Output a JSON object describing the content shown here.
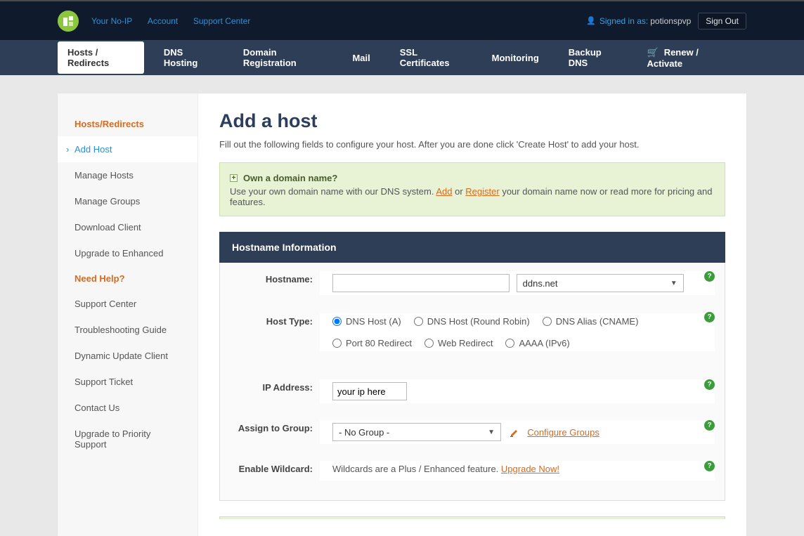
{
  "top": {
    "links": {
      "yourNoIp": "Your No-IP",
      "account": "Account",
      "support": "Support Center"
    },
    "signedInAs": "Signed in as:",
    "username": "potionspvp",
    "signOut": "Sign Out"
  },
  "nav": {
    "hostsRedirects": "Hosts / Redirects",
    "dnsHosting": "DNS Hosting",
    "domainRegistration": "Domain Registration",
    "mail": "Mail",
    "ssl": "SSL Certificates",
    "monitoring": "Monitoring",
    "backupDns": "Backup DNS",
    "renew": "Renew / Activate"
  },
  "sidebar": {
    "heading1": "Hosts/Redirects",
    "addHost": "Add Host",
    "manageHosts": "Manage Hosts",
    "manageGroups": "Manage Groups",
    "downloadClient": "Download Client",
    "upgradeEnhanced": "Upgrade to Enhanced",
    "heading2": "Need Help?",
    "supportCenter": "Support Center",
    "troubleshooting": "Troubleshooting Guide",
    "duc": "Dynamic Update Client",
    "ticket": "Support Ticket",
    "contact": "Contact Us",
    "priority": "Upgrade to Priority Support"
  },
  "page": {
    "title": "Add a host",
    "subtitle": "Fill out the following fields to configure your host. After you are done click 'Create Host' to add your host."
  },
  "infobox": {
    "question": "Own a domain name?",
    "line2a": "Use your own domain name with our DNS system. ",
    "add": "Add",
    "or": " or ",
    "register": "Register",
    "line2b": " your domain name now or read more for pricing and features."
  },
  "panel": {
    "heading": "Hostname Information",
    "labels": {
      "hostname": "Hostname:",
      "hostType": "Host Type:",
      "ip": "IP Address:",
      "group": "Assign to Group:",
      "wildcard": "Enable Wildcard:"
    },
    "hostnameValue": "",
    "domainSelected": "ddns.net",
    "hostTypes": {
      "a": "DNS Host (A)",
      "rr": "DNS Host (Round Robin)",
      "cname": "DNS Alias (CNAME)",
      "port80": "Port 80 Redirect",
      "web": "Web Redirect",
      "aaaa": "AAAA (IPv6)"
    },
    "ipValue": "your ip here",
    "groupSelected": "- No Group -",
    "configureGroups": "Configure Groups",
    "wildcardText": "Wildcards are a Plus / Enhanced feature. ",
    "upgradeNow": "Upgrade Now!"
  }
}
